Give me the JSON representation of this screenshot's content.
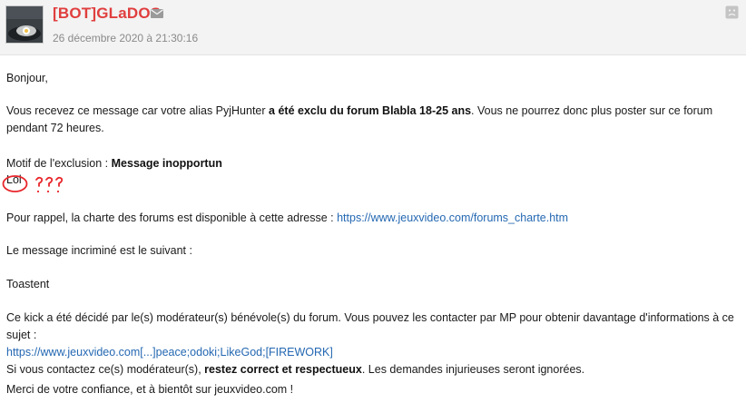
{
  "author": {
    "name": "[BOT]GLaDOS",
    "date": "26 décembre 2020 à 21:30:16"
  },
  "message": {
    "greeting": "Bonjour,",
    "notice_pre": "Vous recevez ce message car votre alias PyjHunter ",
    "notice_bold": "a été exclu du forum Blabla 18-25 ans",
    "notice_post": ". Vous ne pourrez donc plus poster sur ce forum pendant 72 heures.",
    "reason_label": "Motif de l'exclusion : ",
    "reason_value": "Message inopportun",
    "reason_comment": "Lol",
    "charter_text": "Pour rappel, la charte des forums est disponible à cette adresse : ",
    "charter_link": "https://www.jeuxvideo.com/forums_charte.htm",
    "incriminated_intro": "Le message incriminé est le suivant :",
    "incriminated_message": "Toastent",
    "kick_text": "Ce kick a été décidé par le(s) modérateur(s) bénévole(s) du forum. Vous pouvez les contacter par MP pour obtenir davantage d'informations à ce sujet :",
    "moderators_link": "https://www.jeuxvideo.com[...]peace;odoki;LikeGod;[FIREWORK]",
    "contact_pre": "Si vous contactez ce(s) modérateur(s), ",
    "contact_bold": "restez correct et respectueux",
    "contact_post": ". Les demandes injurieuses seront ignorées.",
    "closing": "Merci de votre confiance, et à bientôt sur jeuxvideo.com !"
  },
  "annotation": {
    "text": "???",
    "color": "#e8262b"
  },
  "colors": {
    "author": "#e03e3e",
    "link": "#2468b2",
    "header_bg": "#f3f3f3"
  }
}
